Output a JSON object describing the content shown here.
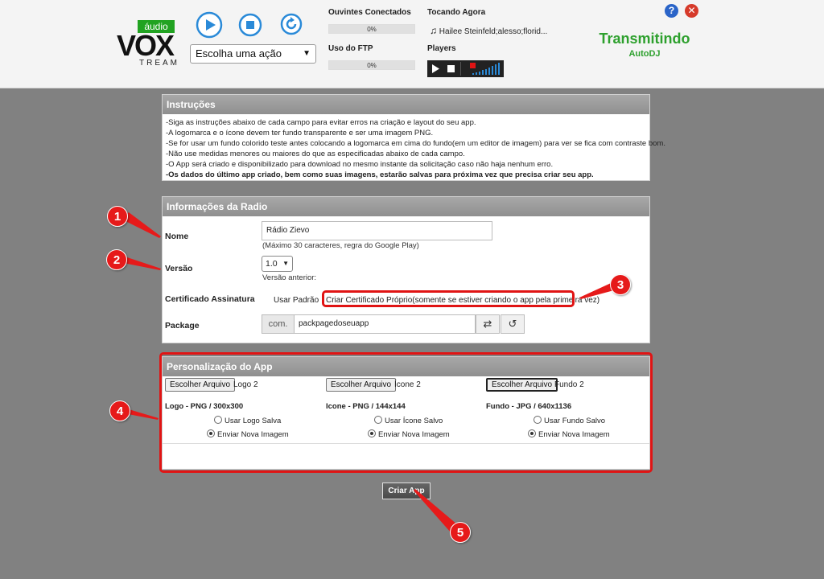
{
  "header": {
    "logo_main": "VOX",
    "logo_sub": "TREAM",
    "audio_tag": "áudio",
    "action_select": "Escolha uma ação",
    "listeners_label": "Ouvintes Conectados",
    "listeners_percent": "0%",
    "ftp_label": "Uso do FTP",
    "ftp_percent": "0%",
    "now_playing_label": "Tocando Agora",
    "now_playing": "Hailee Steinfeld;alesso;florid...",
    "players_label": "Players",
    "help": "?",
    "close": "✕",
    "status": "Transmitindo",
    "substatus": "AutoDJ",
    "colors": {
      "status_green": "#2da02d",
      "brand_blue": "#2a8ad8"
    }
  },
  "instructions": {
    "title": "Instruções",
    "lines": [
      "-Siga as instruções abaixo de cada campo para evitar erros na criação e layout do seu app.",
      "-A logomarca e o ícone devem ter fundo transparente e ser uma imagem PNG.",
      "-Se for usar um fundo colorido teste antes colocando a logomarca em cima do fundo(em um editor de imagem) para ver se fica com contraste bom.",
      "-Não use medidas menores ou maiores do que as especificadas abaixo de cada campo.",
      "-O App será criado e disponibilizado para download no mesmo instante da solicitação caso não haja nenhum erro."
    ],
    "bold_line": "-Os dados do último app criado, bem como suas imagens, estarão salvas para próxima vez que precisa criar seu app."
  },
  "radio_info": {
    "title": "Informações da Radio",
    "name_label": "Nome",
    "name_value": "Rádio Zievo",
    "name_hint": "(Máximo 30 caracteres, regra do Google Play)",
    "version_label": "Versão",
    "version_value": "1.0",
    "version_hint": "Versão anterior:",
    "cert_label": "Certificado Assinatura",
    "cert_default": "Usar Padrão",
    "cert_own": "Criar Certificado Próprio(somente se estiver criando o app pela primeira vez)",
    "package_label": "Package",
    "package_prefix": "com.",
    "package_value": "packpagedoseuapp"
  },
  "customization": {
    "title": "Personalização do App",
    "choose_file": "Escolher Arquivo",
    "logo_file": "Logo 2",
    "icon_file": "Ícone 2",
    "bg_file": "Fundo 2",
    "logo_spec": "Logo - PNG / 300x300",
    "icon_spec": "Icone - PNG / 144x144",
    "bg_spec": "Fundo - JPG / 640x1136",
    "logo_saved": "Usar Logo Salva",
    "icon_saved": "Usar Ícone Salvo",
    "bg_saved": "Usar Fundo Salvo",
    "send_new": "Enviar Nova Imagem"
  },
  "submit": {
    "label": "Criar App"
  },
  "annotations": [
    "1",
    "2",
    "3",
    "4",
    "5"
  ]
}
